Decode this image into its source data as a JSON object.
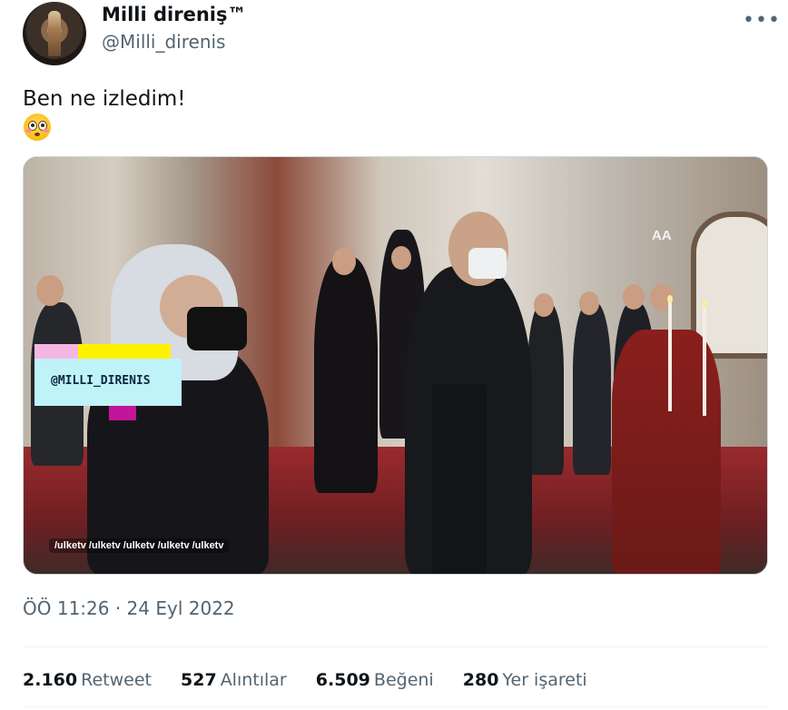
{
  "user": {
    "display_name": "Milli direniş™",
    "handle": "@Milli_direnis",
    "avatar_icon": "profile-avatar"
  },
  "more_icon": "more-options-icon",
  "tweet": {
    "text": "Ben ne izledim!",
    "emoji": "flushed-face-emoji"
  },
  "media": {
    "watermark_text": "@MILLI_DIRENIS",
    "social_handles": "/ulketv  /ulketv  /ulketv  /ulketv  /ulketv",
    "agency_logo": "AA"
  },
  "timestamp": "ÖÖ 11:26 · 24 Eyl 2022",
  "stats": {
    "retweets": {
      "value": "2.160",
      "label": "Retweet"
    },
    "quotes": {
      "value": "527",
      "label": "Alıntılar"
    },
    "likes": {
      "value": "6.509",
      "label": "Beğeni"
    },
    "bookmarks": {
      "value": "280",
      "label": "Yer işareti"
    }
  },
  "colors": {
    "text_primary": "#0f1419",
    "text_secondary": "#536471",
    "divider": "#eff3f4",
    "watermark_bg": "#bff3f7"
  }
}
